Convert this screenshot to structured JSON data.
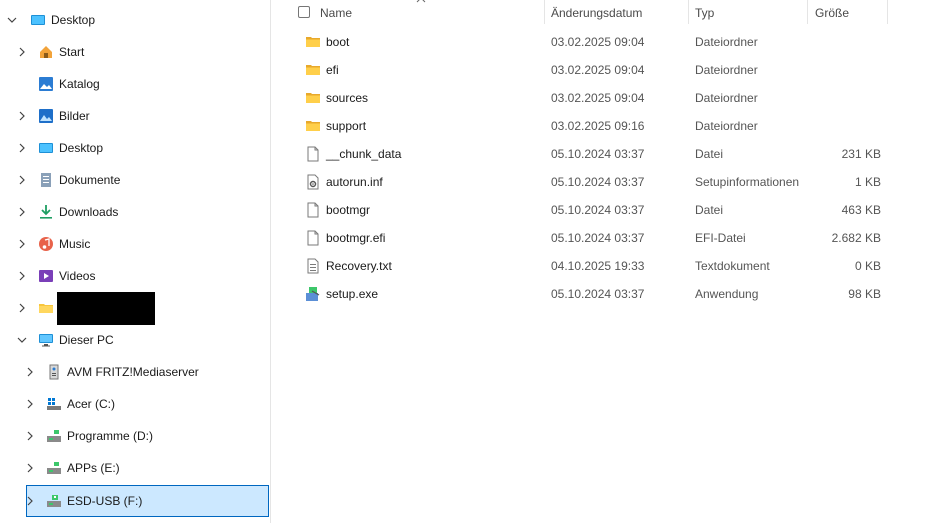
{
  "sidebar": {
    "items": [
      {
        "label": "Desktop",
        "icon": "desktop-icon",
        "expanded": true
      },
      {
        "label": "Start",
        "icon": "home-icon"
      },
      {
        "label": "Katalog",
        "icon": "gallery-icon"
      },
      {
        "label": "Bilder",
        "icon": "pictures-icon"
      },
      {
        "label": "Desktop",
        "icon": "desktop-icon"
      },
      {
        "label": "Dokumente",
        "icon": "documents-icon"
      },
      {
        "label": "Downloads",
        "icon": "downloads-icon"
      },
      {
        "label": "Music",
        "icon": "music-icon"
      },
      {
        "label": "Videos",
        "icon": "videos-icon"
      },
      {
        "label": "",
        "icon": "folder-icon"
      },
      {
        "label": "Dieser PC",
        "icon": "this-pc-icon",
        "expanded": true
      },
      {
        "label": "AVM FRITZ!Mediaserver",
        "icon": "media-server-icon"
      },
      {
        "label": "Acer (C:)",
        "icon": "system-drive-icon"
      },
      {
        "label": "Programme (D:)",
        "icon": "drive-icon"
      },
      {
        "label": "APPs (E:)",
        "icon": "drive-icon"
      },
      {
        "label": "ESD-USB (F:)",
        "icon": "usb-drive-icon",
        "selected": true
      }
    ]
  },
  "columns": {
    "name": "Name",
    "date": "Änderungsdatum",
    "type": "Typ",
    "size": "Größe"
  },
  "files": [
    {
      "name": "boot",
      "date": "03.02.2025 09:04",
      "type": "Dateiordner",
      "size": "",
      "icon": "folder-icon"
    },
    {
      "name": "efi",
      "date": "03.02.2025 09:04",
      "type": "Dateiordner",
      "size": "",
      "icon": "folder-icon"
    },
    {
      "name": "sources",
      "date": "03.02.2025 09:04",
      "type": "Dateiordner",
      "size": "",
      "icon": "folder-icon"
    },
    {
      "name": "support",
      "date": "03.02.2025 09:16",
      "type": "Dateiordner",
      "size": "",
      "icon": "folder-icon"
    },
    {
      "name": "__chunk_data",
      "date": "05.10.2024 03:37",
      "type": "Datei",
      "size": "231 KB",
      "icon": "file-icon"
    },
    {
      "name": "autorun.inf",
      "date": "05.10.2024 03:37",
      "type": "Setupinformationen",
      "size": "1 KB",
      "icon": "settings-file-icon"
    },
    {
      "name": "bootmgr",
      "date": "05.10.2024 03:37",
      "type": "Datei",
      "size": "463 KB",
      "icon": "file-icon"
    },
    {
      "name": "bootmgr.efi",
      "date": "05.10.2024 03:37",
      "type": "EFI-Datei",
      "size": "2.682 KB",
      "icon": "file-icon"
    },
    {
      "name": "Recovery.txt",
      "date": "04.10.2025 19:33",
      "type": "Textdokument",
      "size": "0 KB",
      "icon": "text-file-icon"
    },
    {
      "name": "setup.exe",
      "date": "05.10.2024 03:37",
      "type": "Anwendung",
      "size": "98 KB",
      "icon": "setup-exe-icon"
    }
  ],
  "colors": {
    "selection_bg": "#cce8ff",
    "selection_border": "#0067c0",
    "folder": "#f8c63d"
  }
}
